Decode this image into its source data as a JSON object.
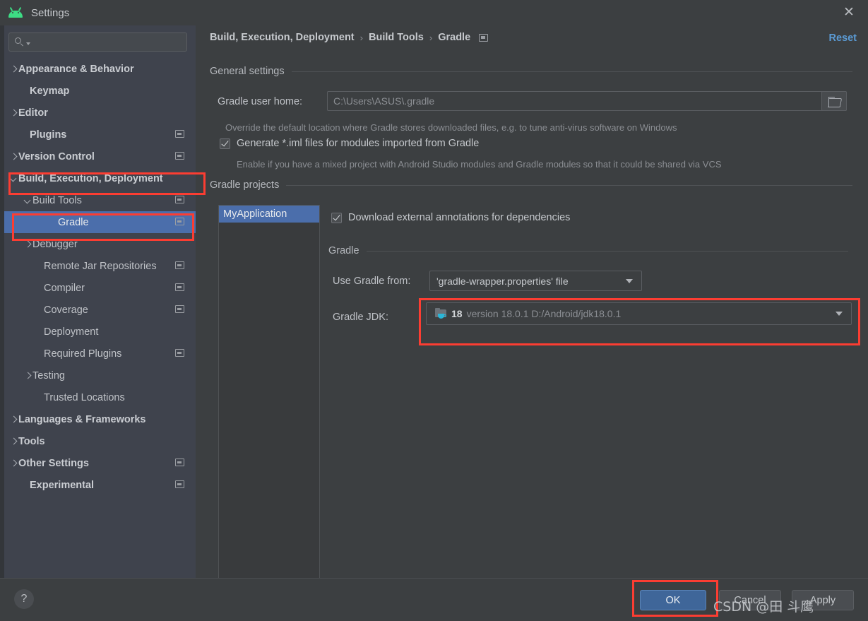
{
  "window": {
    "title": "Settings",
    "logo_icon": "android-logo-icon",
    "close_icon": "close-icon"
  },
  "sidebar": {
    "search": {
      "value": "",
      "placeholder": "",
      "icon": "search-icon"
    },
    "items": [
      {
        "label": "Appearance & Behavior",
        "arrow": "right",
        "bold": true,
        "indent": 22,
        "badge": false,
        "selected": false
      },
      {
        "label": "Keymap",
        "arrow": "none",
        "bold": true,
        "indent": 38,
        "badge": false,
        "selected": false
      },
      {
        "label": "Editor",
        "arrow": "right",
        "bold": true,
        "indent": 22,
        "badge": false,
        "selected": false
      },
      {
        "label": "Plugins",
        "arrow": "none",
        "bold": true,
        "indent": 38,
        "badge": true,
        "selected": false
      },
      {
        "label": "Version Control",
        "arrow": "right",
        "bold": true,
        "indent": 22,
        "badge": true,
        "selected": false
      },
      {
        "label": "Build, Execution, Deployment",
        "arrow": "down",
        "bold": true,
        "indent": 22,
        "badge": false,
        "selected": false
      },
      {
        "label": "Build Tools",
        "arrow": "down",
        "bold": false,
        "indent": 42,
        "badge": true,
        "selected": false
      },
      {
        "label": "Gradle",
        "arrow": "none",
        "bold": false,
        "indent": 78,
        "badge": true,
        "selected": true
      },
      {
        "label": "Debugger",
        "arrow": "right",
        "bold": false,
        "indent": 42,
        "badge": false,
        "selected": false
      },
      {
        "label": "Remote Jar Repositories",
        "arrow": "none",
        "bold": false,
        "indent": 58,
        "badge": true,
        "selected": false
      },
      {
        "label": "Compiler",
        "arrow": "none",
        "bold": false,
        "indent": 58,
        "badge": true,
        "selected": false
      },
      {
        "label": "Coverage",
        "arrow": "none",
        "bold": false,
        "indent": 58,
        "badge": true,
        "selected": false
      },
      {
        "label": "Deployment",
        "arrow": "none",
        "bold": false,
        "indent": 58,
        "badge": false,
        "selected": false
      },
      {
        "label": "Required Plugins",
        "arrow": "none",
        "bold": false,
        "indent": 58,
        "badge": true,
        "selected": false
      },
      {
        "label": "Testing",
        "arrow": "right",
        "bold": false,
        "indent": 42,
        "badge": false,
        "selected": false
      },
      {
        "label": "Trusted Locations",
        "arrow": "none",
        "bold": false,
        "indent": 58,
        "badge": false,
        "selected": false
      },
      {
        "label": "Languages & Frameworks",
        "arrow": "right",
        "bold": true,
        "indent": 22,
        "badge": false,
        "selected": false
      },
      {
        "label": "Tools",
        "arrow": "right",
        "bold": true,
        "indent": 22,
        "badge": false,
        "selected": false
      },
      {
        "label": "Other Settings",
        "arrow": "right",
        "bold": true,
        "indent": 22,
        "badge": true,
        "selected": false
      },
      {
        "label": "Experimental",
        "arrow": "none",
        "bold": true,
        "indent": 38,
        "badge": true,
        "selected": false
      }
    ]
  },
  "breadcrumb": {
    "crumb1": "Build, Execution, Deployment",
    "sep1": "›",
    "crumb2": "Build Tools",
    "sep2": "›",
    "crumb3": "Gradle",
    "badge_icon": "project-scope-icon"
  },
  "header": {
    "reset_label": "Reset"
  },
  "general_settings": {
    "section_title": "General settings",
    "gradle_user_home_label": "Gradle user home:",
    "gradle_user_home_value": "C:\\Users\\ASUS\\.gradle",
    "browse_icon": "folder-icon",
    "hint": "Override the default location where Gradle stores downloaded files, e.g. to tune anti-virus software on Windows",
    "generate_iml_label": "Generate *.iml files for modules imported from Gradle",
    "generate_iml_checked": true,
    "generate_iml_hint": "Enable if you have a mixed project with Android Studio modules and Gradle modules so that it could be shared via VCS"
  },
  "gradle_projects": {
    "section_title": "Gradle projects",
    "projects": [
      {
        "name": "MyApplication",
        "selected": true
      }
    ],
    "download_annotations_label": "Download external annotations for dependencies",
    "download_annotations_checked": true
  },
  "gradle_section": {
    "section_title": "Gradle",
    "use_gradle_from_label": "Use Gradle from:",
    "use_gradle_from_value": "'gradle-wrapper.properties' file",
    "gradle_jdk_label": "Gradle JDK:",
    "gradle_jdk_icon": "jdk-folder-icon",
    "gradle_jdk_version": "18",
    "gradle_jdk_detail": "version 18.0.1 D:/Android/jdk18.0.1"
  },
  "footer": {
    "help_label": "?",
    "ok_label": "OK",
    "cancel_label": "Cancel",
    "apply_label": "Apply"
  },
  "watermark": {
    "text": "CSDN @田  斗鹰"
  },
  "colors": {
    "accent_blue": "#4b6eab",
    "link_blue": "#5b9bd5",
    "annotation_red": "#fc3d32",
    "android_green": "#3ddc84",
    "sidebar_bg": "#3f434d",
    "panel_bg": "#3c3f41"
  }
}
